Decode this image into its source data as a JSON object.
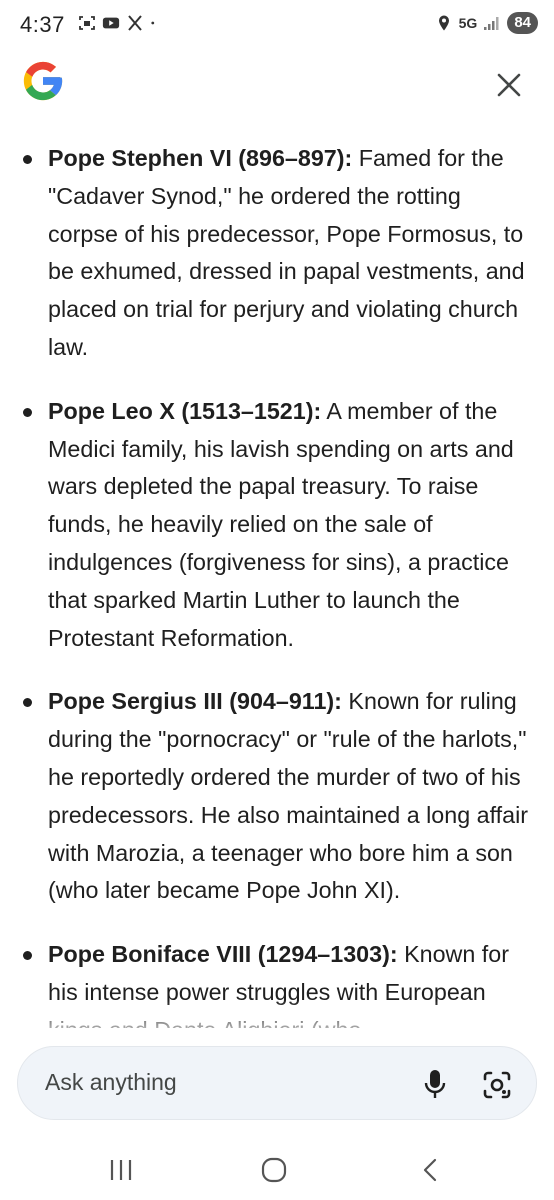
{
  "status_bar": {
    "time": "4:37",
    "network": "5G",
    "battery": "84",
    "icons": [
      "screenshot-icon",
      "youtube-icon",
      "x-logo-icon",
      "dot-icon",
      "location-icon",
      "signal-icon"
    ]
  },
  "header": {
    "logo": "google-g-logo",
    "close_icon": "close-icon"
  },
  "items": [
    {
      "title": "Pope Stephen VI (896–897):",
      "text": " Famed for the \"Cadaver Synod,\" he ordered the rotting corpse of his predecessor, Pope Formosus, to be exhumed, dressed in papal vestments, and placed on trial for perjury and violating church law."
    },
    {
      "title": "Pope Leo X (1513–1521):",
      "text": " A member of the Medici family, his lavish spending on arts and wars depleted the papal treasury. To raise funds, he heavily relied on the sale of indulgences (forgiveness for sins), a practice that sparked Martin Luther to launch the Protestant Reformation."
    },
    {
      "title": "Pope Sergius III (904–911):",
      "text": " Known for ruling during the \"pornocracy\" or \"rule of the harlots,\" he reportedly ordered the murder of two of his predecessors. He also maintained a long affair with Marozia, a teenager who bore him a son (who later became Pope John XI)."
    },
    {
      "title": "Pope Boniface VIII (1294–1303):",
      "text": " Known for his intense power struggles with European kings and Dante Alighieri (who"
    }
  ],
  "input": {
    "placeholder": "Ask anything"
  },
  "nav": {
    "icons": [
      "recent-apps-icon",
      "home-icon",
      "back-icon"
    ]
  },
  "colors": {
    "google_blue": "#4285F4",
    "google_red": "#EA4335",
    "google_yellow": "#FBBC05",
    "google_green": "#34A853",
    "input_bg": "#f0f4f9"
  }
}
